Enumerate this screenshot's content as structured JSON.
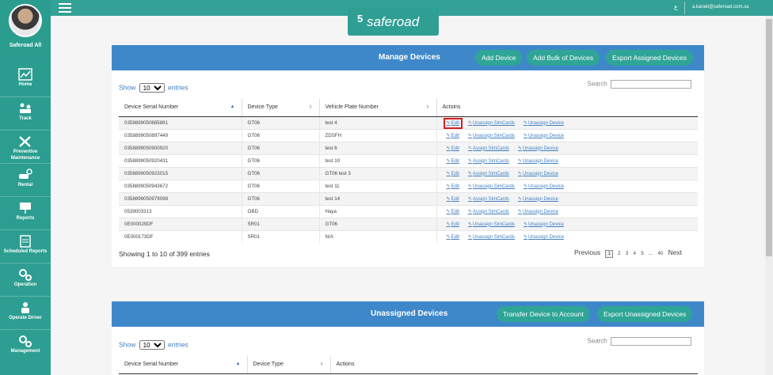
{
  "user": {
    "name": "Saferoad All",
    "email": "a.karaki@saferoad.com.sa"
  },
  "topbar": {
    "lang": "ع"
  },
  "logo": {
    "mark": "5",
    "text": "saferoad"
  },
  "nav": [
    {
      "label": "Home",
      "icon": "chart-icon"
    },
    {
      "label": "Track",
      "icon": "track-icon"
    },
    {
      "label": "Preventive Maintenance",
      "icon": "tools-icon"
    },
    {
      "label": "Rental",
      "icon": "car-key-icon"
    },
    {
      "label": "Reports",
      "icon": "presentation-icon"
    },
    {
      "label": "Scheduled Reports",
      "icon": "clipboard-icon"
    },
    {
      "label": "Operation",
      "icon": "gears-icon"
    },
    {
      "label": "Operate Driver",
      "icon": "driver-icon"
    },
    {
      "label": "Management",
      "icon": "gears-icon"
    }
  ],
  "manage": {
    "title": "Manage Devices",
    "buttons": [
      "Add Device",
      "Add Bulk of Devices",
      "Export Assigned Devices"
    ],
    "show": "Show",
    "entries_value": "10",
    "entries": "entries",
    "search": "Search",
    "columns": [
      "Device Serial Number",
      "Device Type",
      "Vehicle Plate Number",
      "Actoins"
    ],
    "rows": [
      {
        "serial": "0358899050885881",
        "type": "GT06",
        "plate": "test 4",
        "sim": "Unassign SimCards",
        "dev": "Unassign Device"
      },
      {
        "serial": "0358899050897449",
        "type": "GT06",
        "plate": "ZDSFH",
        "sim": "Unassign SimCards",
        "dev": "Unassign Device"
      },
      {
        "serial": "0358899050900920",
        "type": "GT06",
        "plate": "test 6",
        "sim": "Assign SimCards",
        "dev": "Unassign Device"
      },
      {
        "serial": "0358899050920431",
        "type": "GT06",
        "plate": "test 10",
        "sim": "Assign SimCards",
        "dev": "Unassign Device"
      },
      {
        "serial": "0358899050923015",
        "type": "GT06",
        "plate": "GT06 test 3",
        "sim": "Assign SimCards",
        "dev": "Unassign Device"
      },
      {
        "serial": "0358899050943672",
        "type": "GT06",
        "plate": "test 11",
        "sim": "Unassign SimCards",
        "dev": "Unassign Device"
      },
      {
        "serial": "0358899050979098",
        "type": "GT06",
        "plate": "test 14",
        "sim": "Assign SimCards",
        "dev": "Unassign Device"
      },
      {
        "serial": "0539003313",
        "type": "OBD",
        "plate": "Haya",
        "sim": "Assign SimCards",
        "dev": "Unassign Device"
      },
      {
        "serial": "0E000029DF",
        "type": "SR01",
        "plate": "GT06",
        "sim": "Unassign SimCards",
        "dev": "Unassign Device"
      },
      {
        "serial": "0E000173DF",
        "type": "SR01",
        "plate": "N/A",
        "sim": "Unassign SimCards",
        "dev": "Unassign Device"
      }
    ],
    "edit_label": "Edit",
    "info": "Showing 1 to 10 of 399 entries",
    "pager": {
      "prev": "Previous",
      "pages": [
        "1",
        "2",
        "3",
        "4",
        "5"
      ],
      "ellipsis": "...",
      "last": "40",
      "next": "Next"
    }
  },
  "unassigned": {
    "title": "Unassigned Devices",
    "buttons": [
      "Transfer Device to Account",
      "Export Unassigned Devices"
    ],
    "show": "Show",
    "entries_value": "10",
    "entries": "entries",
    "search": "Search",
    "columns": [
      "Device Serial Number",
      "Device Type",
      "Actions"
    ]
  }
}
